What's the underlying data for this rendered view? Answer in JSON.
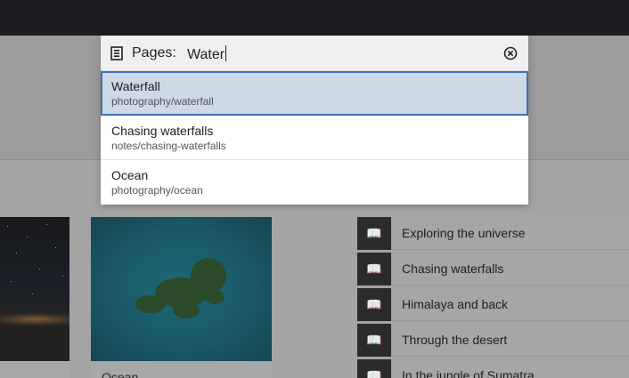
{
  "palette": {
    "icon": "pages-icon",
    "prefix": "Pages:",
    "query": "Water",
    "results": [
      {
        "title": "Waterfall",
        "path": "photography/waterfall",
        "selected": true
      },
      {
        "title": "Chasing waterfalls",
        "path": "notes/chasing-waterfalls",
        "selected": false
      },
      {
        "title": "Ocean",
        "path": "photography/ocean",
        "selected": false
      }
    ]
  },
  "background": {
    "cards": [
      {
        "caption": ""
      },
      {
        "caption": "Ocean"
      }
    ],
    "list": [
      {
        "label": "Exploring the universe"
      },
      {
        "label": "Chasing waterfalls"
      },
      {
        "label": "Himalaya and back"
      },
      {
        "label": "Through the desert"
      },
      {
        "label": "In the jungle of Sumatra"
      }
    ]
  },
  "colors": {
    "topbar": "#1c1d20",
    "selection": "#ced9e6",
    "selection_border": "#3f6fb6"
  }
}
